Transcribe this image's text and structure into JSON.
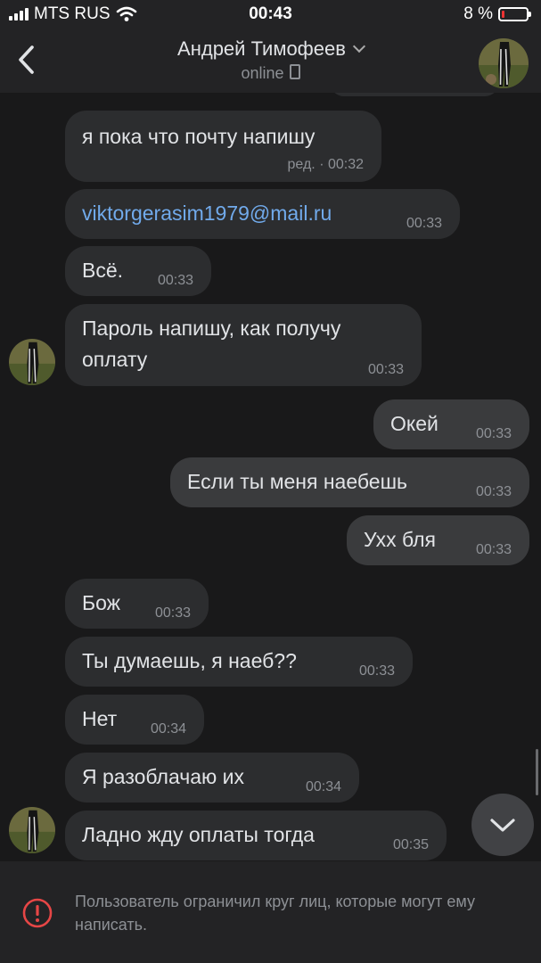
{
  "status_bar": {
    "carrier": "MTS RUS",
    "time": "00:43",
    "battery": "8 %",
    "battery_level": 0.08,
    "signal_bars": 4
  },
  "header": {
    "contact_name": "Андрей Тимофеев",
    "presence": "online",
    "icons": [
      "back-chevron-icon",
      "chevron-down-icon",
      "mobile-phone-icon",
      "avatar"
    ]
  },
  "messages": [
    {
      "text": "я пока что почту напишу",
      "time": "ред. · 00:32",
      "direction": "in"
    },
    {
      "text": "viktorgerasim1979@mail.ru",
      "time": "00:33",
      "direction": "in",
      "link": true
    },
    {
      "text": "Всё.",
      "time": "00:33",
      "direction": "in"
    },
    {
      "text": "Пароль напишу, как получу",
      "text2": "оплату",
      "time": "00:33",
      "direction": "in"
    },
    {
      "text": "Окей",
      "time": "00:33",
      "direction": "out"
    },
    {
      "text": "Если ты меня наебешь",
      "time": "00:33",
      "direction": "out"
    },
    {
      "text": "Ухх бля",
      "time": "00:33",
      "direction": "out"
    },
    {
      "text": "Бож",
      "time": "00:33",
      "direction": "in"
    },
    {
      "text": "Ты думаешь, я наеб??",
      "time": "00:33",
      "direction": "in"
    },
    {
      "text": "Нет",
      "time": "00:34",
      "direction": "in"
    },
    {
      "text": "Я разоблачаю их",
      "time": "00:34",
      "direction": "in"
    },
    {
      "text": "Ладно жду оплаты тогда",
      "time": "00:35",
      "direction": "in"
    }
  ],
  "footer": {
    "notice": "Пользователь ограничил круг лиц, которые могут ему написать.",
    "icon": "warning-circle-icon"
  },
  "colors": {
    "background": "#19191a",
    "bars": "#232325",
    "bubble_in": "#2c2d2f",
    "bubble_out": "#3a3b3d",
    "link": "#71aaeb",
    "warning": "#e64646",
    "battery_low": "#ee3333"
  }
}
